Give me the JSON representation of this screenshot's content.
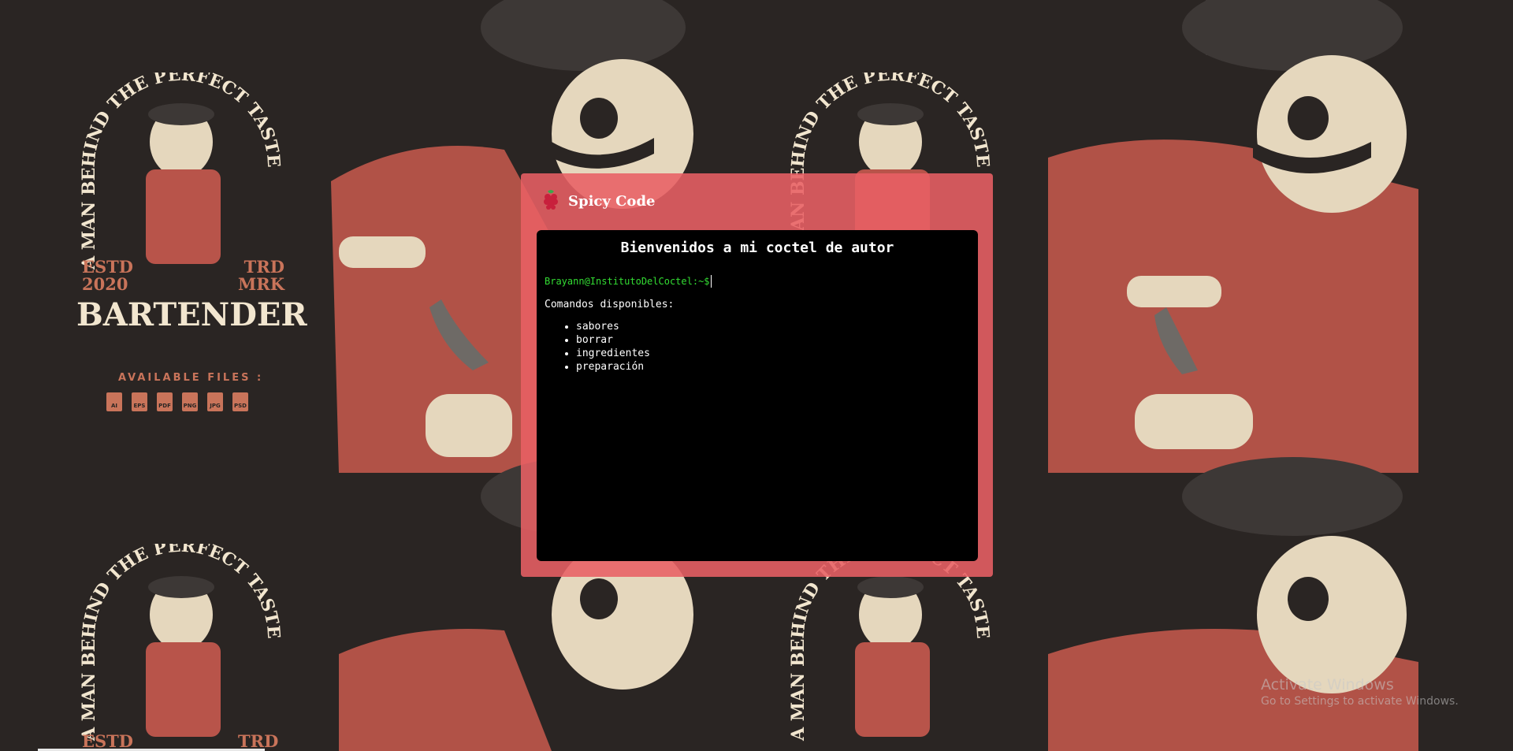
{
  "background": {
    "poster_arc_text": "A MAN BEHIND THE PERFECT TASTE",
    "estd_left": "ESTD",
    "estd_year": "2020",
    "trd_right": "TRD",
    "mrk_right": "MRK",
    "brand": "BARTENDER",
    "files_title": "AVAILABLE FILES :",
    "file_types": [
      "AI",
      "EPS",
      "PDF",
      "PNG",
      "JPG",
      "PSD"
    ],
    "estd_bottom": "ESTD",
    "trd_bottom": "TRD",
    "colors": {
      "bg": "#2a2523",
      "cream": "#f2e6cf",
      "rust": "#c9745a"
    }
  },
  "window": {
    "title": "Spicy Code",
    "logo_icon": "raspberry-icon",
    "accent": "#e86064"
  },
  "terminal": {
    "heading": "Bienvenidos a mi coctel de autor",
    "prompt": "Brayann@InstitutoDelCoctel:~$",
    "commands_label": "Comandos disponibles:",
    "commands": [
      "sabores",
      "borrar",
      "ingredientes",
      "preparación"
    ]
  },
  "watermark": {
    "title": "Activate Windows",
    "subtitle": "Go to Settings to activate Windows."
  }
}
